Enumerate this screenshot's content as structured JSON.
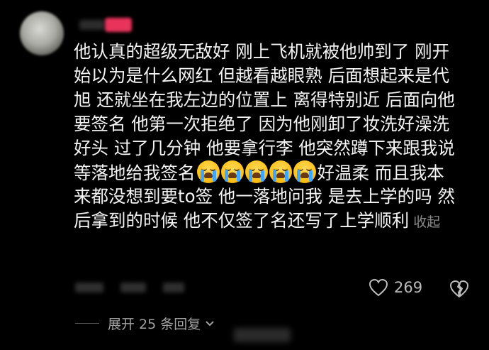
{
  "comment": {
    "user": {
      "name": "",
      "badge": ""
    },
    "lines": [
      "他认真的超级无敌好 刚上飞机就被他帅到了 刚开",
      "始以为是什么网红 但越看越眼熟 后面想起来是代",
      "旭 还就坐在我左边的位置上 离得特别近 后面向他",
      "要签名 他第一次拒绝了 因为他刚卸了妆洗好澡洗",
      "好头 过了几分钟 他要拿行李 他突然蹲下来跟我说"
    ],
    "line6_before": "等落地给我签名",
    "line6_emoji_count": 5,
    "line6_after": "好温柔 而且我本",
    "lines_tail": [
      "来都没想到要to签 他一落地问我 是去上学的吗 然"
    ],
    "last_line": "后拿到的时候 他不仅签了名还写了上学顺利",
    "collapse_label": "收起"
  },
  "actions": {
    "like_count": "269",
    "like_icon": "heart-outline-icon",
    "dislike_icon": "broken-heart-icon"
  },
  "replies": {
    "expand_label": "展开 25 条回复"
  },
  "colors": {
    "background": "#000000",
    "text": "#f4f4f4",
    "muted": "#8a8a8a",
    "badge": "#e8335a"
  }
}
